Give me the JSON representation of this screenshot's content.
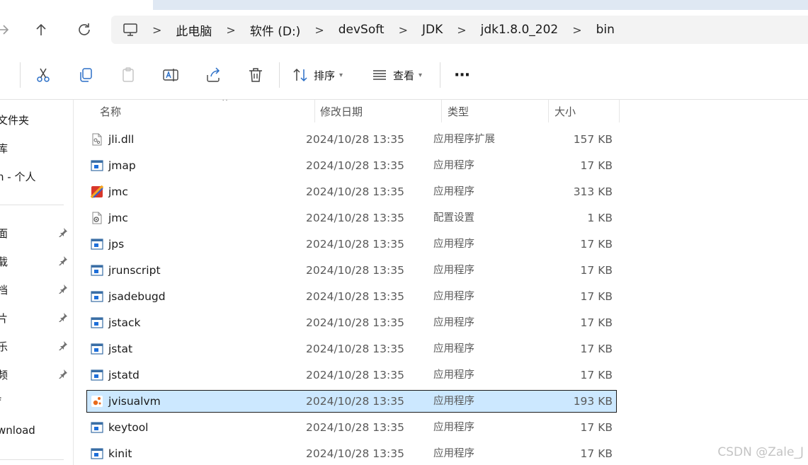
{
  "breadcrumb": {
    "items": [
      "此电脑",
      "软件 (D:)",
      "devSoft",
      "JDK",
      "jdk1.8.0_202",
      "bin"
    ],
    "separator": ">"
  },
  "toolbar": {
    "sort_label": "排序",
    "view_label": "查看",
    "more_label": "···"
  },
  "sidebar": {
    "items": [
      {
        "label": "文件夹",
        "pinned": false
      },
      {
        "label": "库",
        "pinned": false
      },
      {
        "label": "n - 个人",
        "pinned": false
      },
      {
        "label": "面",
        "pinned": true
      },
      {
        "label": "载",
        "pinned": true
      },
      {
        "label": "档",
        "pinned": true
      },
      {
        "label": "片",
        "pinned": true
      },
      {
        "label": "乐",
        "pinned": true
      },
      {
        "label": "频",
        "pinned": true
      },
      {
        "label": "f",
        "pinned": false
      },
      {
        "label": "wnload",
        "pinned": false
      }
    ]
  },
  "columns": {
    "name": "名称",
    "date": "修改日期",
    "type": "类型",
    "size": "大小"
  },
  "files": [
    {
      "name": "jli.dll",
      "date": "2024/10/28 13:35",
      "type": "应用程序扩展",
      "size": "157 KB",
      "icon": "dll-file-icon"
    },
    {
      "name": "jmap",
      "date": "2024/10/28 13:35",
      "type": "应用程序",
      "size": "17 KB",
      "icon": "exe-app-icon"
    },
    {
      "name": "jmc",
      "date": "2024/10/28 13:35",
      "type": "应用程序",
      "size": "313 KB",
      "icon": "jmc-app-icon"
    },
    {
      "name": "jmc",
      "date": "2024/10/28 13:35",
      "type": "配置设置",
      "size": "1 KB",
      "icon": "config-file-icon"
    },
    {
      "name": "jps",
      "date": "2024/10/28 13:35",
      "type": "应用程序",
      "size": "17 KB",
      "icon": "exe-app-icon"
    },
    {
      "name": "jrunscript",
      "date": "2024/10/28 13:35",
      "type": "应用程序",
      "size": "17 KB",
      "icon": "exe-app-icon"
    },
    {
      "name": "jsadebugd",
      "date": "2024/10/28 13:35",
      "type": "应用程序",
      "size": "17 KB",
      "icon": "exe-app-icon"
    },
    {
      "name": "jstack",
      "date": "2024/10/28 13:35",
      "type": "应用程序",
      "size": "17 KB",
      "icon": "exe-app-icon"
    },
    {
      "name": "jstat",
      "date": "2024/10/28 13:35",
      "type": "应用程序",
      "size": "17 KB",
      "icon": "exe-app-icon"
    },
    {
      "name": "jstatd",
      "date": "2024/10/28 13:35",
      "type": "应用程序",
      "size": "17 KB",
      "icon": "exe-app-icon"
    },
    {
      "name": "jvisualvm",
      "date": "2024/10/28 13:35",
      "type": "应用程序",
      "size": "193 KB",
      "icon": "visualvm-app-icon",
      "selected": true
    },
    {
      "name": "keytool",
      "date": "2024/10/28 13:35",
      "type": "应用程序",
      "size": "17 KB",
      "icon": "exe-app-icon"
    },
    {
      "name": "kinit",
      "date": "2024/10/28 13:35",
      "type": "应用程序",
      "size": "17 KB",
      "icon": "exe-app-icon"
    }
  ],
  "watermark": "CSDN @Zale_J",
  "colors": {
    "selection": "#cce8ff",
    "address_bg": "#f3f3f3",
    "accent_blue": "#1e6fd9"
  }
}
